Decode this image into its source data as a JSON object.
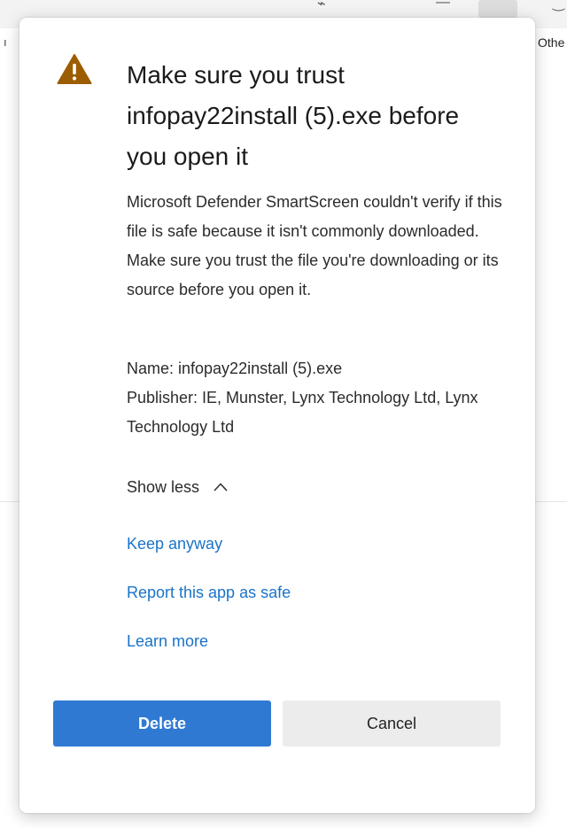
{
  "browser": {
    "favorites_left_fragment": "ı",
    "favorites_right_fragment": "Othe"
  },
  "dialog": {
    "title": "Make sure you trust infopay22install (5).exe before you open it",
    "body": "Microsoft Defender SmartScreen couldn't verify if this file is safe because it isn't commonly downloaded. Make sure you trust the file you're downloading or its source before you open it.",
    "file_name": "Name: infopay22install (5).exe",
    "publisher": "Publisher: IE, Munster, Lynx Technology Ltd, Lynx Technology Ltd",
    "show_less_label": "Show less",
    "links": {
      "keep_anyway": "Keep anyway",
      "report_safe": "Report this app as safe",
      "learn_more": "Learn more"
    },
    "buttons": {
      "delete": "Delete",
      "cancel": "Cancel"
    }
  },
  "icons": {
    "warning": "warning-triangle-icon",
    "chevron": "chevron-up-icon"
  },
  "colors": {
    "warning_icon": "#9c5d00",
    "link": "#1a73c8",
    "primary_button": "#2f79d3",
    "secondary_button": "#ececec"
  }
}
